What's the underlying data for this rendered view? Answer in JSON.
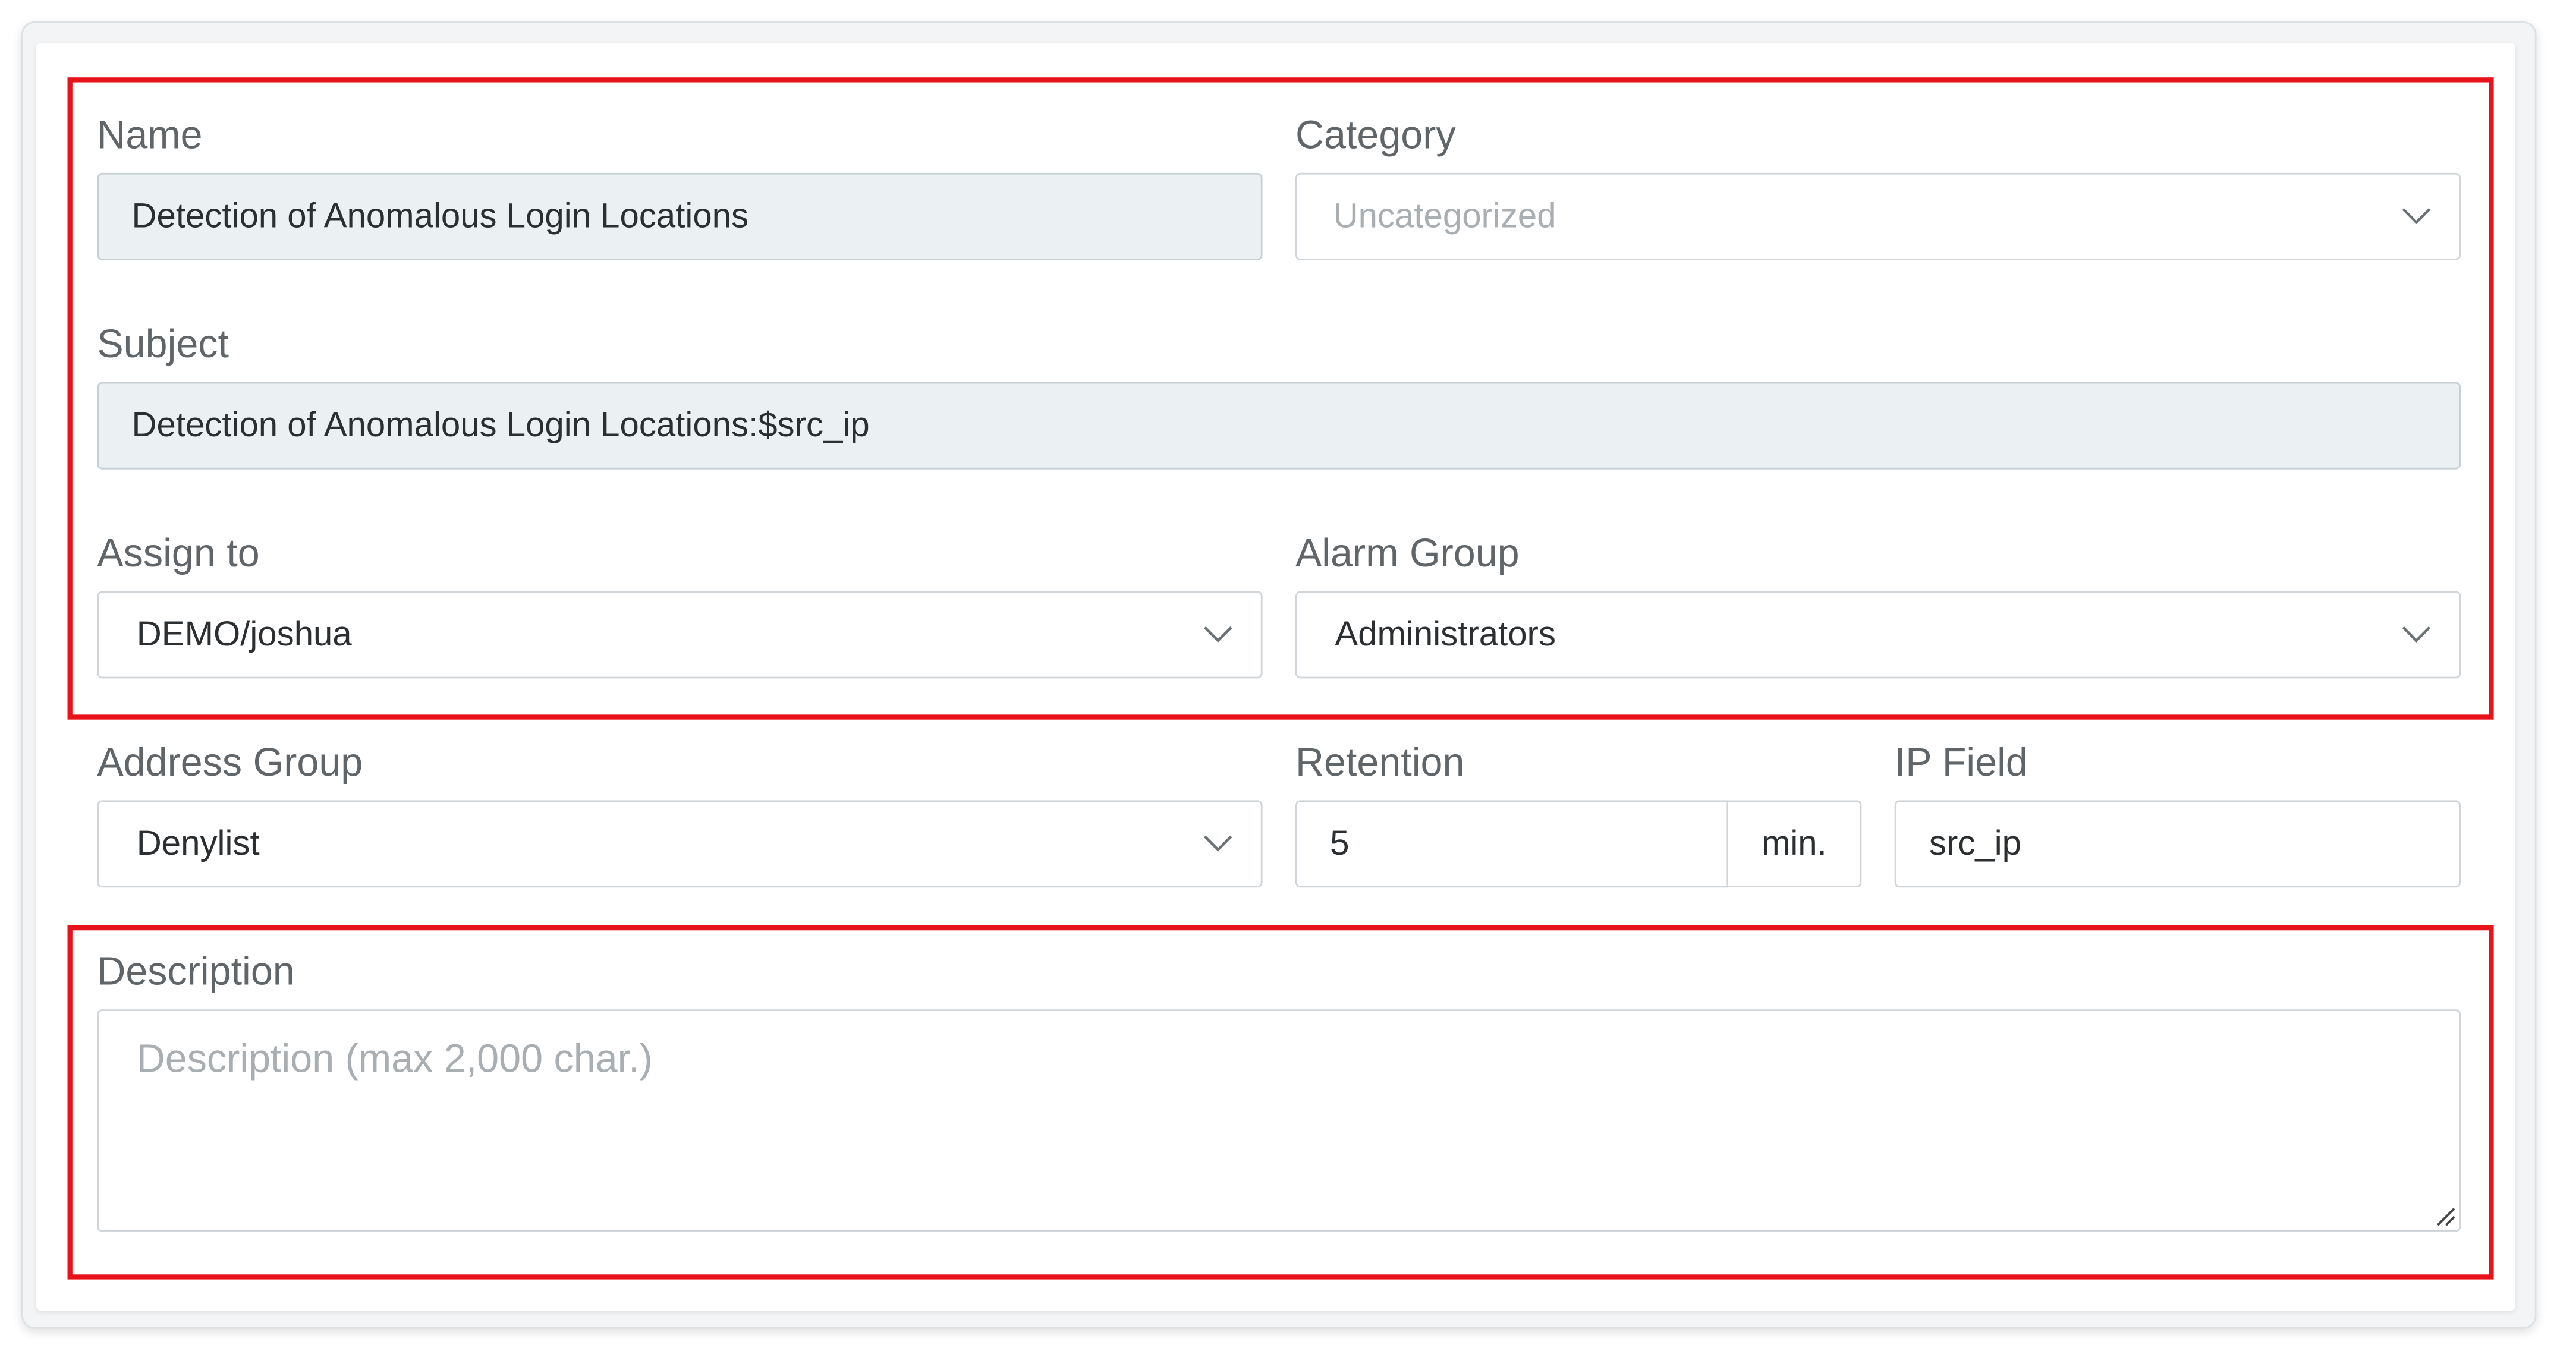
{
  "name": {
    "label": "Name",
    "value": "Detection of Anomalous Login Locations"
  },
  "category": {
    "label": "Category",
    "placeholder": "Uncategorized",
    "icon": "chevron-down-icon"
  },
  "subject": {
    "label": "Subject",
    "value": "Detection of Anomalous Login Locations:$src_ip"
  },
  "assign_to": {
    "label": "Assign to",
    "value": "DEMO/joshua",
    "icon": "chevron-down-icon"
  },
  "alarm_group": {
    "label": "Alarm Group",
    "value": "Administrators",
    "icon": "chevron-down-icon"
  },
  "address_group": {
    "label": "Address Group",
    "value": "Denylist",
    "icon": "chevron-down-icon"
  },
  "retention": {
    "label": "Retention",
    "value": "5",
    "unit": "min."
  },
  "ip_field": {
    "label": "IP Field",
    "value": "src_ip"
  },
  "description": {
    "label": "Description",
    "placeholder": "Description (max 2,000 char.)",
    "icon": "resize-handle-icon"
  },
  "colors": {
    "highlight": "#e8121b",
    "readonly_bg": "#ebf1f3",
    "label_text": "#5f6568",
    "placeholder_text": "#a8aeb1"
  }
}
